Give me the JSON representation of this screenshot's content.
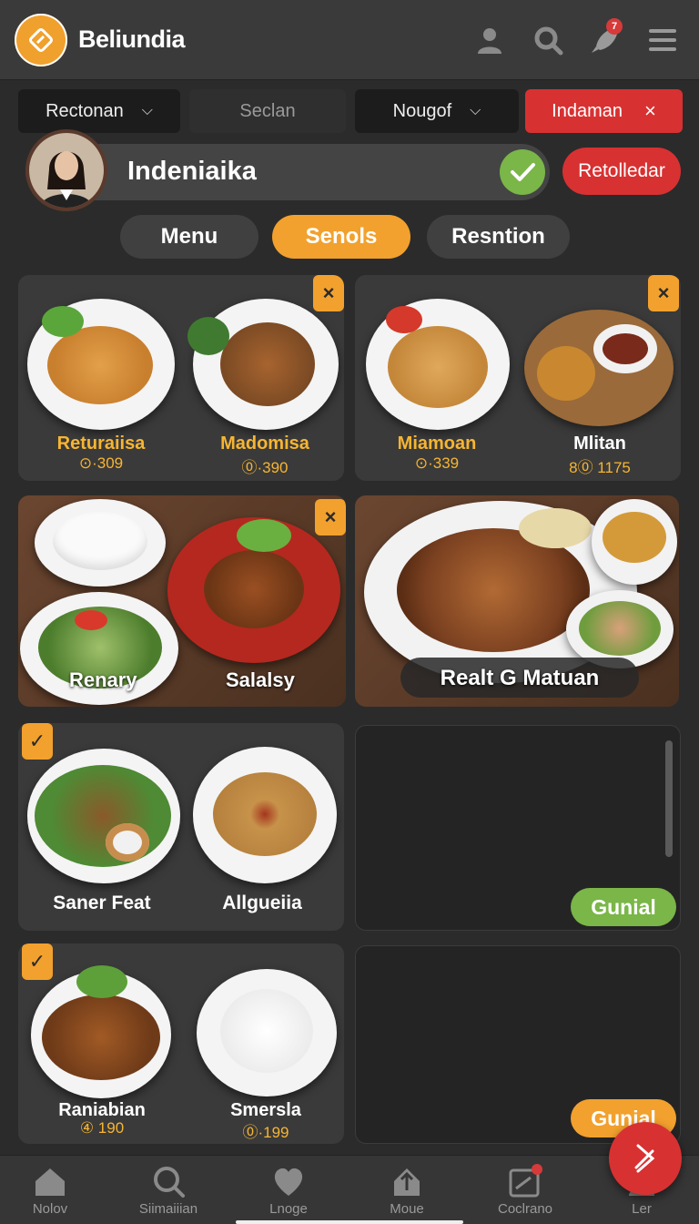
{
  "app": {
    "title": "Beliundia"
  },
  "header_icons": {
    "notifications_count": "7"
  },
  "filters": [
    {
      "label": "Rectonan",
      "chevron": "⌄"
    },
    {
      "label": "Seclan"
    },
    {
      "label": "Nougof",
      "chevron": "⌄"
    },
    {
      "label": "Indaman",
      "close": "×"
    }
  ],
  "profile": {
    "name": "Indeniaika",
    "action_label": "Retolledar"
  },
  "tabs": [
    {
      "label": "Menu",
      "active": false
    },
    {
      "label": "Senols",
      "active": true
    },
    {
      "label": "Resntion",
      "active": false
    }
  ],
  "cards": {
    "card1": {
      "dishes": [
        {
          "name": "Returaiisa",
          "price": "⊙·309"
        },
        {
          "name": "Madomisa",
          "price": "⓪·390"
        }
      ],
      "badge": "×"
    },
    "card2": {
      "dishes": [
        {
          "name": "Miamoan",
          "price": "⊙·339"
        },
        {
          "name": "Mlitan",
          "price": "8⓪ 1175"
        }
      ],
      "badge": "×"
    },
    "photo1": {
      "labels": [
        "Renary",
        "Salalsy"
      ],
      "badge": "×"
    },
    "photo2": {
      "label": "Realt G Matuan"
    },
    "card3": {
      "dishes": [
        {
          "name": "Saner Feat"
        },
        {
          "name": "Allgueiia"
        }
      ],
      "badge": "✓"
    },
    "panel1": {
      "button": "Gunial"
    },
    "card4": {
      "dishes": [
        {
          "name": "Raniabian",
          "price": "④ 190"
        },
        {
          "name": "Smersla",
          "price": "⓪·199"
        }
      ],
      "badge": "✓"
    },
    "panel2": {
      "button": "Gunial"
    }
  },
  "bottom_nav": [
    {
      "label": "Nolov",
      "icon": "home-icon"
    },
    {
      "label": "Siimaiiian",
      "icon": "search-icon"
    },
    {
      "label": "Lnoge",
      "icon": "heart-icon"
    },
    {
      "label": "Moue",
      "icon": "house-up-icon"
    },
    {
      "label": "Coclrano",
      "icon": "calendar-icon"
    },
    {
      "label": "Ler",
      "icon": "user-icon"
    }
  ],
  "colors": {
    "accent": "#f2a12e",
    "danger": "#d83132",
    "success": "#7ab648",
    "background": "#2b2b2b"
  }
}
